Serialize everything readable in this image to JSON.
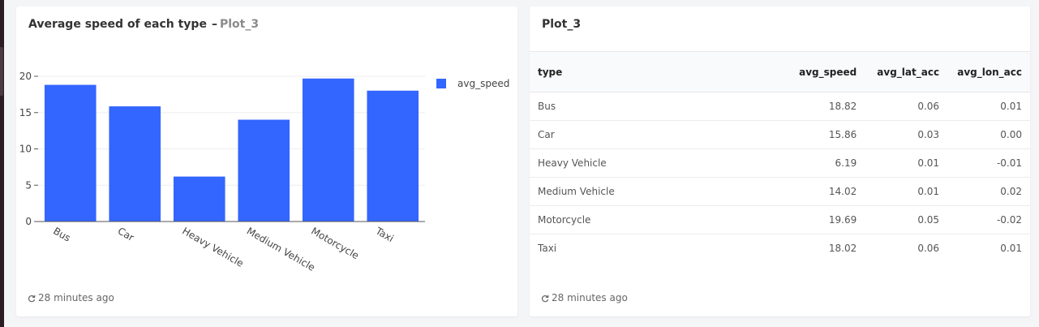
{
  "chart_card": {
    "title": "Average speed of each type",
    "separator": "–",
    "subtitle": "Plot_3",
    "updated": "28 minutes ago",
    "refresh_icon": "refresh-icon"
  },
  "table_card": {
    "title": "Plot_3",
    "updated": "28 minutes ago",
    "refresh_icon": "refresh-icon",
    "columns": [
      "type",
      "avg_speed",
      "avg_lat_acc",
      "avg_lon_acc"
    ],
    "rows": [
      [
        "Bus",
        "18.82",
        "0.06",
        "0.01"
      ],
      [
        "Car",
        "15.86",
        "0.03",
        "0.00"
      ],
      [
        "Heavy Vehicle",
        "6.19",
        "0.01",
        "-0.01"
      ],
      [
        "Medium Vehicle",
        "14.02",
        "0.01",
        "0.02"
      ],
      [
        "Motorcycle",
        "19.69",
        "0.05",
        "-0.02"
      ],
      [
        "Taxi",
        "18.02",
        "0.06",
        "0.01"
      ]
    ]
  },
  "colors": {
    "bar": "#3366ff",
    "grid": "#eeeeee",
    "axis": "#555555"
  },
  "chart_data": {
    "type": "bar",
    "categories": [
      "Bus",
      "Car",
      "Heavy Vehicle",
      "Medium Vehicle",
      "Motorcycle",
      "Taxi"
    ],
    "series": [
      {
        "name": "avg_speed",
        "values": [
          18.82,
          15.86,
          6.19,
          14.02,
          19.69,
          18.02
        ]
      }
    ],
    "yticks": [
      "0",
      "5",
      "10",
      "15",
      "20"
    ],
    "ylim": [
      0,
      20
    ],
    "xlabel": "",
    "ylabel": "",
    "grid": true,
    "legend": "right"
  }
}
